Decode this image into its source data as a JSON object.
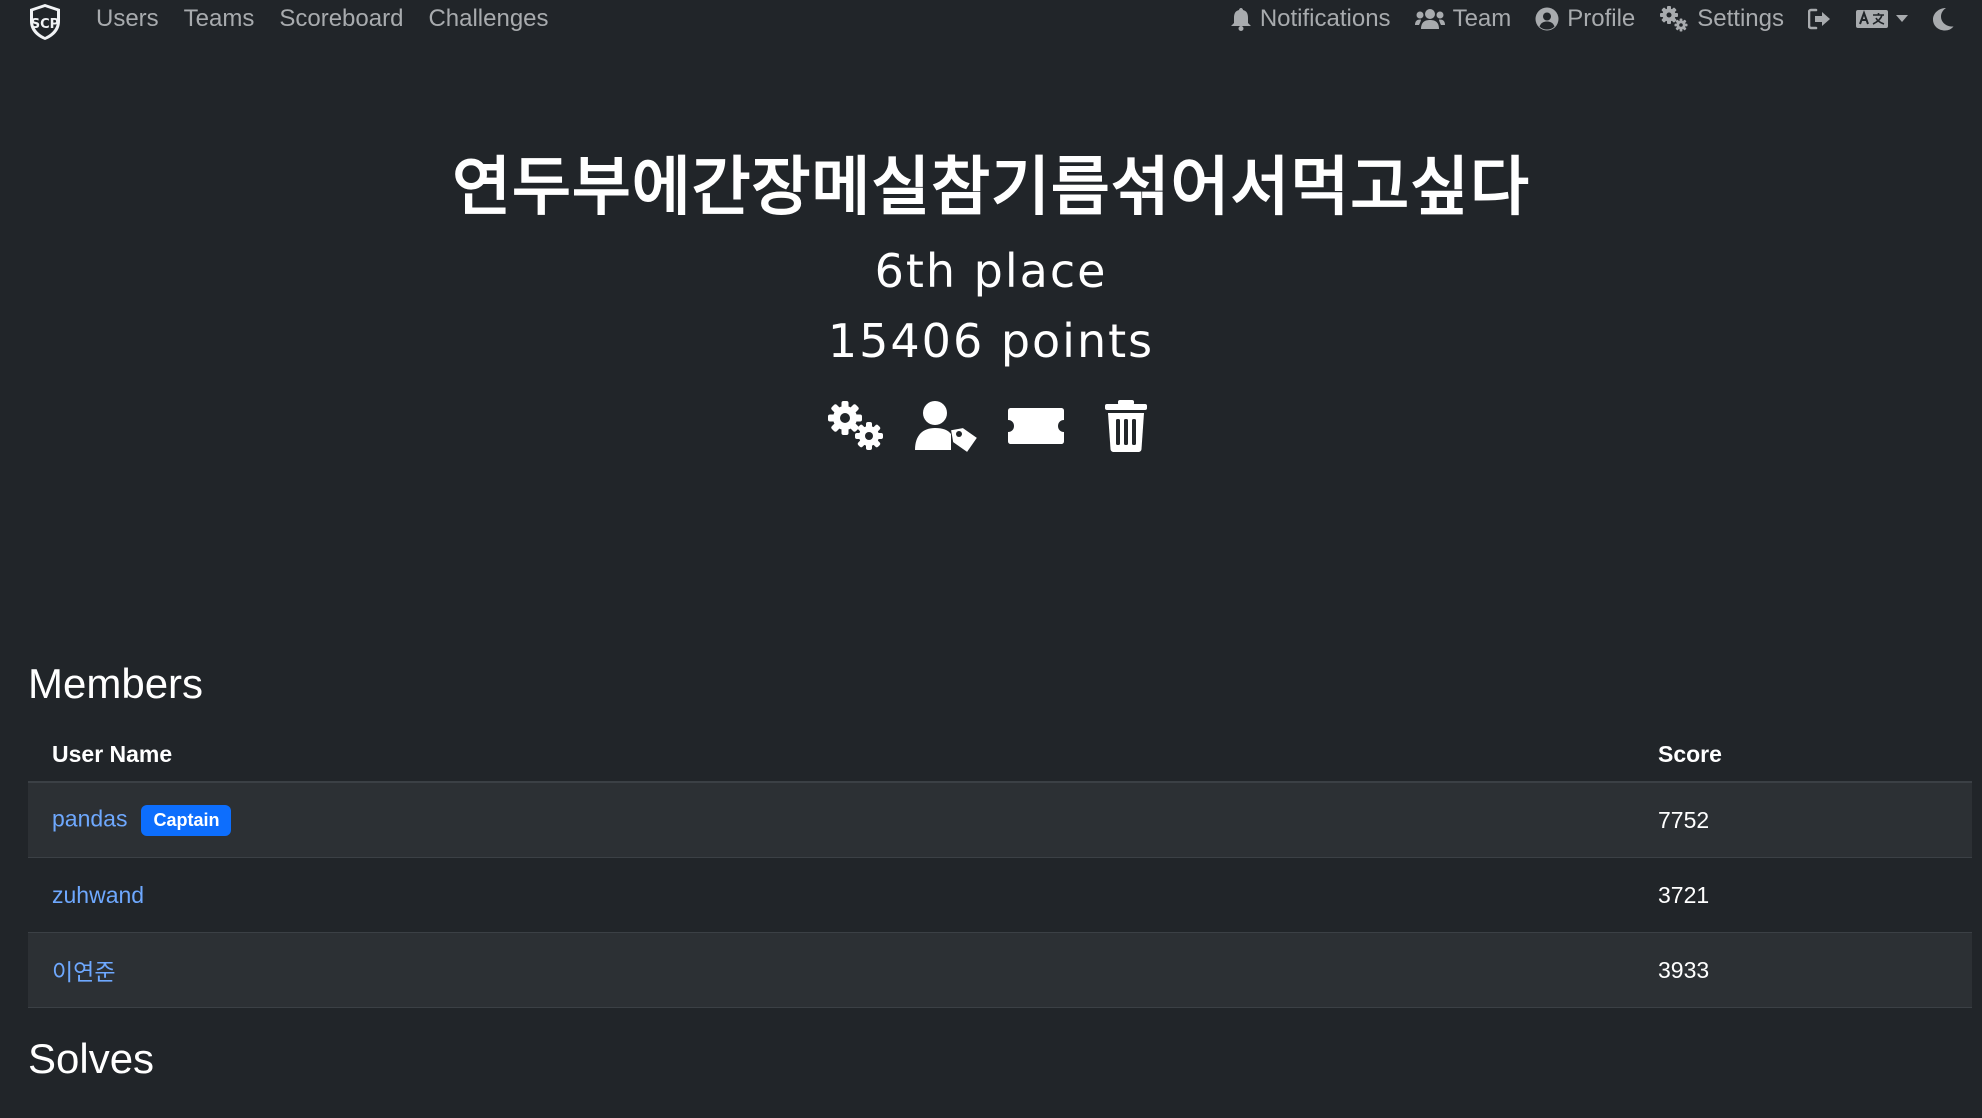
{
  "nav": {
    "brand_text": "SCP",
    "left": [
      "Users",
      "Teams",
      "Scoreboard",
      "Challenges"
    ],
    "notifications": "Notifications",
    "team": "Team",
    "profile": "Profile",
    "settings": "Settings"
  },
  "team": {
    "name": "연두부에간장메실참기름섞어서먹고싶다",
    "place": "6th place",
    "points": "15406 points"
  },
  "members": {
    "title": "Members",
    "headers": [
      "User Name",
      "Score"
    ],
    "captain_badge": "Captain",
    "rows": [
      {
        "name": "pandas",
        "score": "7752",
        "captain": true
      },
      {
        "name": "zuhwand",
        "score": "3721",
        "captain": false
      },
      {
        "name": "이연준",
        "score": "3933",
        "captain": false
      }
    ]
  },
  "solves": {
    "title": "Solves"
  },
  "colors": {
    "background": "#212529",
    "link": "#6ea8fe",
    "badge": "#0d6efd",
    "nav_text": "#a8abae"
  }
}
